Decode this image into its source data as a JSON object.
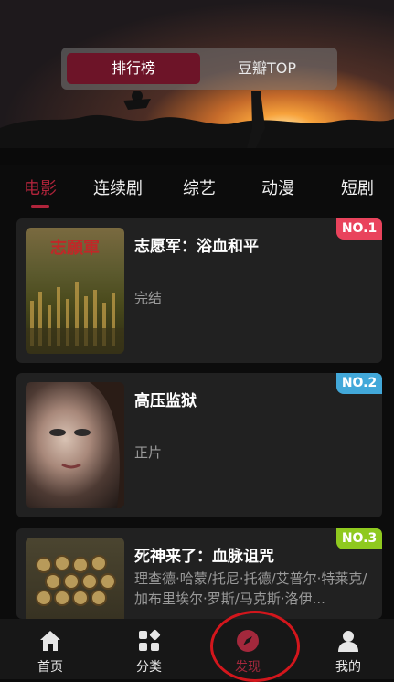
{
  "header": {
    "segments": [
      {
        "label": "排行榜",
        "active": true
      },
      {
        "label": "豆瓣TOP",
        "active": false
      }
    ]
  },
  "categories": [
    {
      "label": "电影",
      "active": true
    },
    {
      "label": "连续剧",
      "active": false
    },
    {
      "label": "综艺",
      "active": false
    },
    {
      "label": "动漫",
      "active": false
    },
    {
      "label": "短剧",
      "active": false
    }
  ],
  "items": [
    {
      "rank": "NO.1",
      "rank_color": "#e9435c",
      "title": "志愿军：浴血和平",
      "status": "完结"
    },
    {
      "rank": "NO.2",
      "rank_color": "#42a8d9",
      "title": "高压监狱",
      "status": "正片"
    },
    {
      "rank": "NO.3",
      "rank_color": "#8fc91f",
      "title": "死神来了：血脉诅咒",
      "cast": "理查德·哈蒙/托尼·托德/艾普尔·特莱克/加布里埃尔·罗斯/马克斯·洛伊..."
    }
  ],
  "poster_text": "志願軍",
  "tabbar": {
    "tabs": [
      {
        "label": "首页",
        "icon": "home-icon",
        "active": false
      },
      {
        "label": "分类",
        "icon": "category-icon",
        "active": false
      },
      {
        "label": "发现",
        "icon": "compass-icon",
        "active": true
      },
      {
        "label": "我的",
        "icon": "user-icon",
        "active": false
      }
    ]
  },
  "colors": {
    "accent": "#a3283c",
    "background": "#0c0c0c",
    "card": "#212121"
  }
}
